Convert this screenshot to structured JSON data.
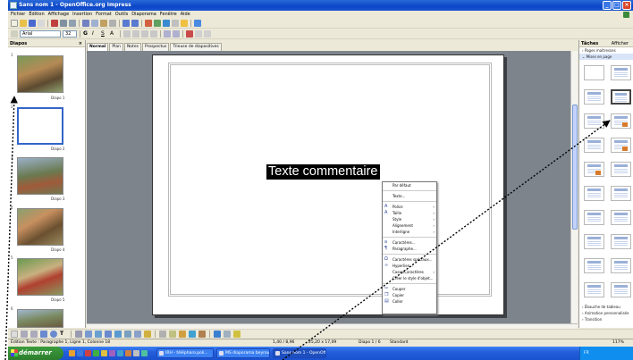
{
  "window": {
    "title": "Sans nom 1 - OpenOffice.org Impress"
  },
  "menu": [
    "Fichier",
    "Édition",
    "Affichage",
    "Insertion",
    "Format",
    "Outils",
    "Diaporama",
    "Fenêtre",
    "Aide"
  ],
  "toolbar": {
    "font_name": "Arial",
    "font_size": "32"
  },
  "slides_panel": {
    "title": "Diapos",
    "slides": [
      {
        "number": "1",
        "label": "Diapo 1"
      },
      {
        "number": "2",
        "label": "Diapo 2"
      },
      {
        "number": "3",
        "label": "Diapo 3"
      },
      {
        "number": "4",
        "label": "Diapo 4"
      },
      {
        "number": "5",
        "label": "Diapo 5"
      },
      {
        "number": "6",
        "label": ""
      }
    ]
  },
  "view_tabs": [
    "Normal",
    "Plan",
    "Notes",
    "Prospectus",
    "Trieuse de diapositives"
  ],
  "slide": {
    "text": "Texte commentaire"
  },
  "context_menu": {
    "items": [
      {
        "label": "Par défaut",
        "icon": "",
        "submenu": false
      },
      {
        "sep": true
      },
      {
        "label": "Texte...",
        "icon": "",
        "submenu": false
      },
      {
        "sep": true
      },
      {
        "label": "Police",
        "icon": "font-icon",
        "submenu": true
      },
      {
        "label": "Taille",
        "icon": "font-size-icon",
        "submenu": true
      },
      {
        "label": "Style",
        "icon": "",
        "submenu": true
      },
      {
        "label": "Alignement",
        "icon": "",
        "submenu": true
      },
      {
        "label": "Interligne",
        "icon": "",
        "submenu": true
      },
      {
        "sep": true
      },
      {
        "label": "Caractères...",
        "icon": "character-icon",
        "submenu": false
      },
      {
        "label": "Paragraphe...",
        "icon": "paragraph-icon",
        "submenu": false
      },
      {
        "sep": true
      },
      {
        "label": "Caractères spéciaux...",
        "icon": "special-chars-icon",
        "submenu": false
      },
      {
        "label": "Hyperlien...",
        "icon": "hyperlink-icon",
        "submenu": false
      },
      {
        "label": "Casse/Caractères",
        "icon": "",
        "submenu": true
      },
      {
        "label": "Créer le style d'objet...",
        "icon": "",
        "submenu": false
      },
      {
        "sep": true
      },
      {
        "label": "Couper",
        "icon": "cut-icon",
        "submenu": false
      },
      {
        "label": "Copier",
        "icon": "copy-icon",
        "submenu": false
      },
      {
        "label": "Coller",
        "icon": "paste-icon",
        "submenu": false
      }
    ]
  },
  "tasks_panel": {
    "title": "Tâches",
    "view_label": "Afficher",
    "sections_top": [
      {
        "label": "Pages maîtresses",
        "open": false
      },
      {
        "label": "Mises en page",
        "open": true
      }
    ],
    "sections_bottom": [
      {
        "label": "Ébauche de tableau",
        "open": false
      },
      {
        "label": "Animation personnalisée",
        "open": false
      },
      {
        "label": "Transition",
        "open": false
      }
    ]
  },
  "status": {
    "edit_info": "Édition Texte : Paragraphe 1, Ligne 1, Colonne 18",
    "position": "1,40 / 8,96",
    "size": "25,20 x 17,09",
    "slide": "Diapo 1 / 6",
    "master": "Standard",
    "zoom": "117%"
  },
  "taskbar": {
    "start_label": "démarrer",
    "tasks": [
      {
        "label": "IRH - télépharo.poli..."
      },
      {
        "label": "MS diaporama beyrou..."
      },
      {
        "label": "Sans nom 1 - OpenOff..."
      }
    ],
    "tray_text": "FR"
  },
  "colors": {
    "title_bar": "#0a46c8",
    "taskbar": "#245edb",
    "start_button": "#2d7d2d",
    "workspace": "#7e848c",
    "selected_text_bg": "#000000",
    "selected_text_fg": "#ffffff"
  }
}
